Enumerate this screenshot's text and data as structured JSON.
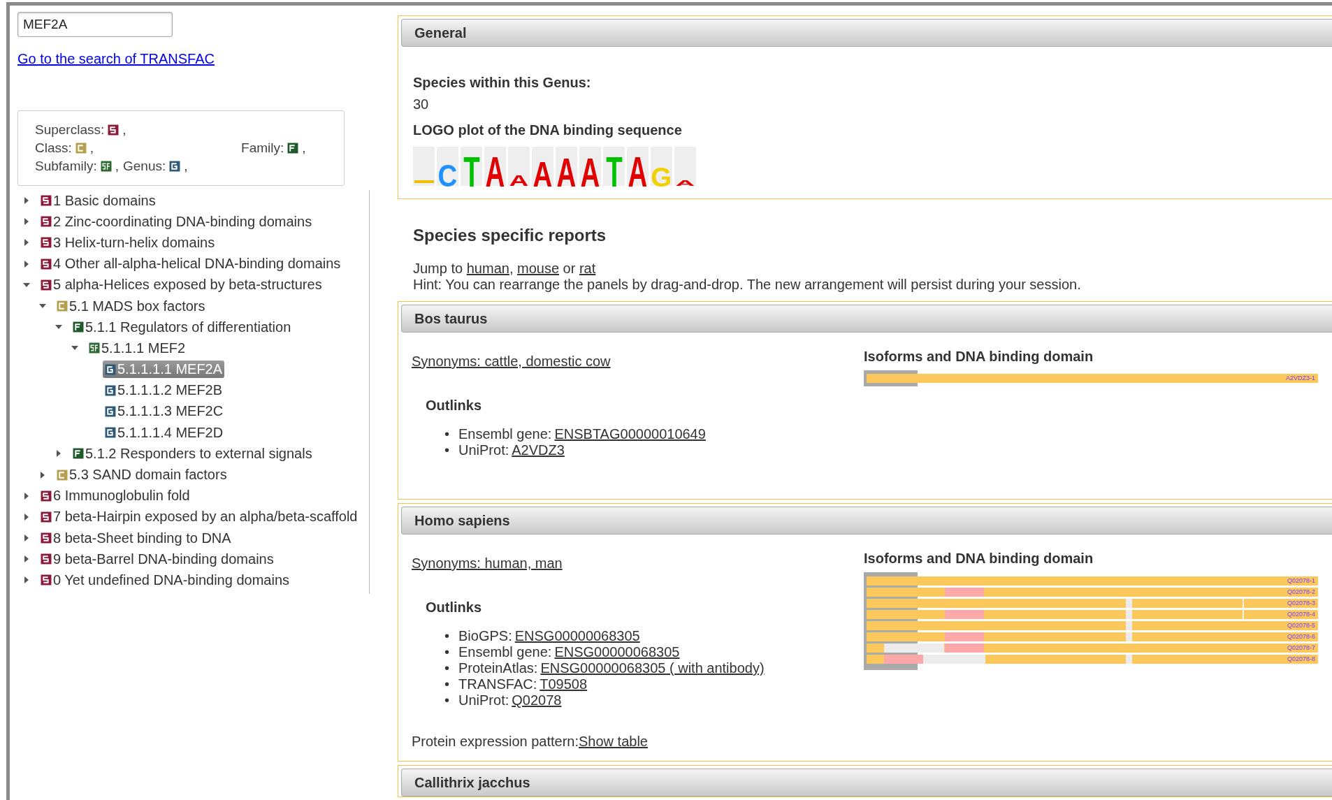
{
  "search": {
    "value": "MEF2A"
  },
  "search_link": "Go to the search of TRANSFAC",
  "legend": [
    {
      "label": "Superclass:",
      "kind": "superclass",
      "sep": ","
    },
    {
      "label": "Class:",
      "kind": "class",
      "sep": ","
    },
    {
      "label": "Family:",
      "kind": "family",
      "sep": ","
    },
    {
      "label": "Subfamily:",
      "kind": "subfamily",
      "sep": ","
    },
    {
      "label": "Genus:",
      "kind": "genus",
      "sep": ","
    }
  ],
  "tree": [
    {
      "label": "1 Basic domains",
      "kind": "superclass",
      "expanded": false,
      "selected": false
    },
    {
      "label": "2 Zinc-coordinating DNA-binding domains",
      "kind": "superclass",
      "expanded": false,
      "selected": false
    },
    {
      "label": "3 Helix-turn-helix domains",
      "kind": "superclass",
      "expanded": false,
      "selected": false
    },
    {
      "label": "4 Other all-alpha-helical DNA-binding domains",
      "kind": "superclass",
      "expanded": false,
      "selected": false
    },
    {
      "label": "5 alpha-Helices exposed by beta-structures",
      "kind": "superclass",
      "expanded": true,
      "selected": false,
      "children": [
        {
          "label": "5.1 MADS box factors",
          "kind": "class",
          "expanded": true,
          "selected": false,
          "children": [
            {
              "label": "5.1.1 Regulators of differentiation",
              "kind": "family",
              "expanded": true,
              "selected": false,
              "children": [
                {
                  "label": "5.1.1.1 MEF2",
                  "kind": "subfamily",
                  "expanded": true,
                  "selected": false,
                  "children": [
                    {
                      "label": "5.1.1.1.1 MEF2A",
                      "kind": "genus",
                      "selected": true
                    },
                    {
                      "label": "5.1.1.1.2 MEF2B",
                      "kind": "genus",
                      "selected": false
                    },
                    {
                      "label": "5.1.1.1.3 MEF2C",
                      "kind": "genus",
                      "selected": false
                    },
                    {
                      "label": "5.1.1.1.4 MEF2D",
                      "kind": "genus",
                      "selected": false
                    }
                  ]
                }
              ]
            },
            {
              "label": "5.1.2 Responders to external signals",
              "kind": "family",
              "expanded": false,
              "selected": false
            }
          ]
        },
        {
          "label": "5.3 SAND domain factors",
          "kind": "class",
          "expanded": false,
          "selected": false
        }
      ]
    },
    {
      "label": "6 Immunoglobulin fold",
      "kind": "superclass",
      "expanded": false,
      "selected": false
    },
    {
      "label": "7 beta-Hairpin exposed by an alpha/beta-scaffold",
      "kind": "superclass",
      "expanded": false,
      "selected": false
    },
    {
      "label": "8 beta-Sheet binding to DNA",
      "kind": "superclass",
      "expanded": false,
      "selected": false
    },
    {
      "label": "9 beta-Barrel DNA-binding domains",
      "kind": "superclass",
      "expanded": false,
      "selected": false
    },
    {
      "label": "0 Yet undefined DNA-binding domains",
      "kind": "superclass",
      "expanded": false,
      "selected": false
    }
  ],
  "general": {
    "title": "General",
    "species_label": "Species within this Genus:",
    "species_count": "30",
    "logo_title": "LOGO plot of the DNA binding sequence",
    "logo": [
      {
        "color": "#f0c000"
      },
      {
        "letter": "C",
        "color": "#1e90ff"
      },
      {
        "letter": "T",
        "color": "#00c000"
      },
      {
        "letter": "A",
        "color": "#e00000"
      },
      {
        "letter": "A",
        "color": "#e00000"
      },
      {
        "letter": "A",
        "color": "#e00000"
      },
      {
        "letter": "A",
        "color": "#e00000"
      },
      {
        "letter": "A",
        "color": "#e00000"
      },
      {
        "letter": "T",
        "color": "#00c000"
      },
      {
        "letter": "A",
        "color": "#e00000"
      },
      {
        "letter": "G",
        "color": "#f0d000"
      },
      {
        "letter": "A",
        "color": "#e00000"
      }
    ]
  },
  "reports": {
    "title": "Species specific reports",
    "jump_prefix": "Jump to",
    "jump_links": [
      "human",
      "mouse",
      "rat"
    ],
    "jump_separators": [
      ",",
      "or"
    ],
    "hint": "Hint: You can rearrange the panels by drag-and-drop. The new arrangement will persist during your session."
  },
  "species": [
    {
      "title": "Bos taurus",
      "synonyms": "Synonyms: cattle, domestic cow",
      "isoforms_title": "Isoforms and DNA binding domain",
      "isoforms": [
        "A2VDZ3-1"
      ],
      "outlinks_title": "Outlinks",
      "outlinks": [
        {
          "bullet": "•",
          "label": "Ensembl gene:",
          "link": "ENSBTAG00000010649"
        },
        {
          "bullet": "•",
          "label": "UniProt:",
          "link": "A2VDZ3"
        }
      ]
    },
    {
      "title": "Homo sapiens",
      "synonyms": "Synonyms: human, man",
      "isoforms_title": "Isoforms and DNA binding domain",
      "isoforms": [
        "Q02078-1",
        "Q02078-2",
        "Q02078-3",
        "Q02078-4",
        "Q02078-5",
        "Q02078-6",
        "Q02078-7",
        "Q02078-8"
      ],
      "outlinks_title": "Outlinks",
      "outlinks": [
        {
          "bullet": "•",
          "label": "BioGPS:",
          "link": "ENSG00000068305"
        },
        {
          "bullet": "•",
          "label": "Ensembl gene:",
          "link": "ENSG00000068305"
        },
        {
          "bullet": "•",
          "label": "ProteinAtlas:",
          "link": "ENSG00000068305 ( with antibody)"
        },
        {
          "bullet": "•",
          "label": "TRANSFAC:",
          "link": "T09508"
        },
        {
          "bullet": "•",
          "label": "UniProt:",
          "link": "Q02078"
        }
      ],
      "expression_label": "Protein expression pattern:",
      "expression_link": "Show table"
    },
    {
      "title": "Callithrix jacchus"
    }
  ]
}
